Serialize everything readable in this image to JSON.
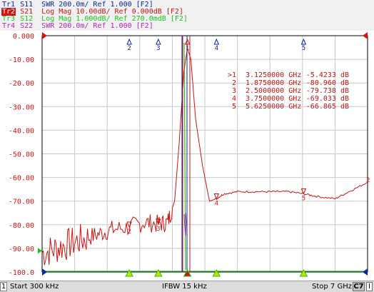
{
  "traces": [
    {
      "tag": "Tr1",
      "text": " S11  SWR 200.0m/ Ref 1.000 [F2]",
      "color": "#0a28a0"
    },
    {
      "tag": "Tr2",
      "text": " S21  Log Mag 10.00dB/ Ref 0.000dB [F2]",
      "color": "#d21414"
    },
    {
      "tag": "Tr3",
      "text": " S12  Log Mag 1.000dB/ Ref 270.0mdB [F2]",
      "color": "#19c819"
    },
    {
      "tag": "Tr4",
      "text": " S22  SWR 200.0m/ Ref 1.000 [F2]",
      "color": "#b428b4"
    }
  ],
  "y_ticks": [
    "0.000",
    "-10.00",
    "-20.00",
    "-30.00",
    "-40.00",
    "-50.00",
    "-60.00",
    "-70.00",
    "-80.00",
    "-90.00",
    "-100.0"
  ],
  "markers_table": [
    {
      "id": ">1",
      "freq": "3.1250000 GHz",
      "value": "-5.4233 dB"
    },
    {
      "id": "2",
      "freq": "1.8750000 GHz",
      "value": "-80.960 dB"
    },
    {
      "id": "3",
      "freq": "2.5000000 GHz",
      "value": "-79.738 dB"
    },
    {
      "id": "4",
      "freq": "3.7500000 GHz",
      "value": "-69.033 dB"
    },
    {
      "id": "5",
      "freq": "5.6250000 GHz",
      "value": "-66.865 dB"
    }
  ],
  "top_markers": [
    "1",
    "2",
    "3",
    "4",
    "5"
  ],
  "status": {
    "channel": "1",
    "start": "Start 300 kHz",
    "ifbw": "IFBW 15 kHz",
    "stop": "Stop 7 GHz",
    "c7": "C7",
    "indicator": "I"
  },
  "chart_data": {
    "type": "line",
    "x_unit": "GHz",
    "xlim": [
      0.0003,
      7
    ],
    "ylim": [
      -100,
      0
    ],
    "grid": true,
    "series": [
      {
        "name": "S21",
        "color": "#d21414",
        "x": [
          0.0003,
          0.3,
          0.6,
          0.9,
          1.2,
          1.5,
          1.875,
          2.2,
          2.5,
          2.7,
          2.85,
          2.95,
          3.05,
          3.125,
          3.2,
          3.3,
          3.45,
          3.6,
          3.75,
          3.9,
          4.2,
          4.6,
          5.0,
          5.3,
          5.625,
          5.9,
          6.3,
          6.6,
          7.0
        ],
        "y": [
          -92,
          -90,
          -88,
          -86,
          -84,
          -82,
          -81,
          -79,
          -79.7,
          -79,
          -70,
          -45,
          -15,
          -5.4,
          -10,
          -35,
          -55,
          -70,
          -69,
          -67,
          -66,
          -66,
          -66,
          -66,
          -66.9,
          -68,
          -69,
          -66,
          -62
        ]
      }
    ]
  }
}
